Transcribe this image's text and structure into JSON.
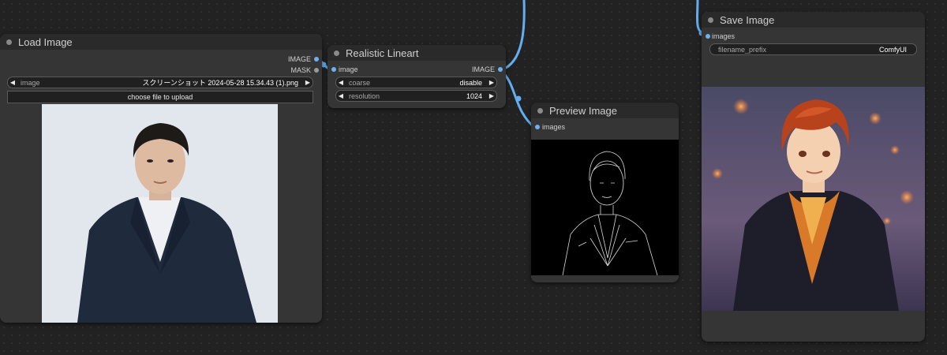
{
  "nodes": {
    "load_image": {
      "title": "Load Image",
      "outputs": [
        "IMAGE",
        "MASK"
      ],
      "image_widget": {
        "label": "image",
        "value": "スクリーンショット 2024-05-28 15.34.43 (1).png"
      },
      "upload_button": "choose file to upload"
    },
    "realistic_lineart": {
      "title": "Realistic Lineart",
      "input": "image",
      "output": "IMAGE",
      "widgets": [
        {
          "label": "coarse",
          "value": "disable"
        },
        {
          "label": "resolution",
          "value": "1024"
        }
      ]
    },
    "preview_image": {
      "title": "Preview Image",
      "input": "images"
    },
    "save_image": {
      "title": "Save Image",
      "input": "images",
      "widget": {
        "label": "filename_prefix",
        "value": "ComfyUI"
      }
    }
  },
  "colors": {
    "link": "#64aef0",
    "node_bg": "#353535",
    "title_bg": "#2a2a2a",
    "canvas_bg": "#222222"
  },
  "icons": {
    "left": "◀",
    "right": "▶"
  }
}
